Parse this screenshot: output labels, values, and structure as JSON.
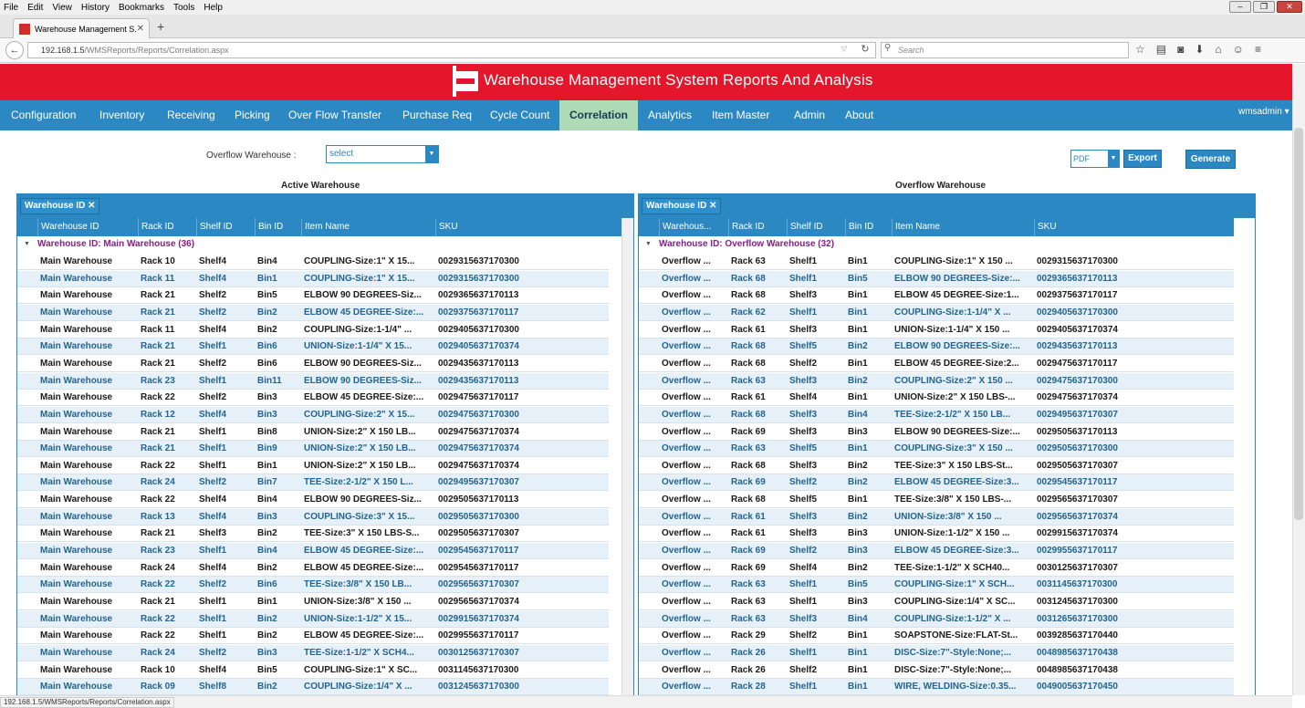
{
  "browser": {
    "menus": [
      "File",
      "Edit",
      "View",
      "History",
      "Bookmarks",
      "Tools",
      "Help"
    ],
    "tab_title": "Warehouse Management S...",
    "url_host": "192.168.1.5",
    "url_path": "/WMSReports/Reports/Correlation.aspx",
    "search_placeholder": "Search",
    "status_url": "192.168.1.5/WMSReports/Reports/Correlation.aspx"
  },
  "app": {
    "title": "Warehouse Management System Reports And Analysis",
    "user": "wmsadmin",
    "nav": [
      "Configuration",
      "Inventory",
      "Receiving",
      "Picking",
      "Over Flow Transfer",
      "Purchase Req",
      "Cycle Count",
      "Correlation",
      "Analytics",
      "Item Master",
      "Admin",
      "About"
    ],
    "active_nav": "Correlation"
  },
  "filters": {
    "overflow_label": "Overflow Warehouse :",
    "overflow_value": "select",
    "format_value": "PDF",
    "export_label": "Export",
    "generate_label": "Generate"
  },
  "active": {
    "title": "Active Warehouse",
    "chip": "Warehouse ID",
    "columns": [
      "Warehouse ID",
      "Rack ID",
      "Shelf ID",
      "Bin ID",
      "Item Name",
      "SKU"
    ],
    "group": "Warehouse ID: Main Warehouse (36)",
    "rows": [
      [
        "Main Warehouse",
        "Rack 10",
        "Shelf4",
        "Bin4",
        "COUPLING-Size:1\" X 15...",
        "0029315637170300"
      ],
      [
        "Main Warehouse",
        "Rack 11",
        "Shelf4",
        "Bin1",
        "COUPLING-Size:1\" X 15...",
        "0029315637170300"
      ],
      [
        "Main Warehouse",
        "Rack 21",
        "Shelf2",
        "Bin5",
        "ELBOW 90 DEGREES-Siz...",
        "0029365637170113"
      ],
      [
        "Main Warehouse",
        "Rack 21",
        "Shelf2",
        "Bin2",
        "ELBOW 45 DEGREE-Size:...",
        "0029375637170117"
      ],
      [
        "Main Warehouse",
        "Rack 11",
        "Shelf4",
        "Bin2",
        "COUPLING-Size:1-1/4\" ...",
        "0029405637170300"
      ],
      [
        "Main Warehouse",
        "Rack 21",
        "Shelf1",
        "Bin6",
        "UNION-Size:1-1/4\" X 15...",
        "0029405637170374"
      ],
      [
        "Main Warehouse",
        "Rack 21",
        "Shelf2",
        "Bin6",
        "ELBOW 90 DEGREES-Siz...",
        "0029435637170113"
      ],
      [
        "Main Warehouse",
        "Rack 23",
        "Shelf1",
        "Bin11",
        "ELBOW 90 DEGREES-Siz...",
        "0029435637170113"
      ],
      [
        "Main Warehouse",
        "Rack 22",
        "Shelf2",
        "Bin3",
        "ELBOW 45 DEGREE-Size:...",
        "0029475637170117"
      ],
      [
        "Main Warehouse",
        "Rack 12",
        "Shelf4",
        "Bin3",
        "COUPLING-Size:2\" X 15...",
        "0029475637170300"
      ],
      [
        "Main Warehouse",
        "Rack 21",
        "Shelf1",
        "Bin8",
        "UNION-Size:2\" X 150 LB...",
        "0029475637170374"
      ],
      [
        "Main Warehouse",
        "Rack 21",
        "Shelf1",
        "Bin9",
        "UNION-Size:2\" X 150 LB...",
        "0029475637170374"
      ],
      [
        "Main Warehouse",
        "Rack 22",
        "Shelf1",
        "Bin1",
        "UNION-Size:2\" X 150 LB...",
        "0029475637170374"
      ],
      [
        "Main Warehouse",
        "Rack 24",
        "Shelf2",
        "Bin7",
        "TEE-Size:2-1/2\" X 150 L...",
        "0029495637170307"
      ],
      [
        "Main Warehouse",
        "Rack 22",
        "Shelf4",
        "Bin4",
        "ELBOW 90 DEGREES-Siz...",
        "0029505637170113"
      ],
      [
        "Main Warehouse",
        "Rack 13",
        "Shelf4",
        "Bin3",
        "COUPLING-Size:3\" X 15...",
        "0029505637170300"
      ],
      [
        "Main Warehouse",
        "Rack 21",
        "Shelf3",
        "Bin2",
        "TEE-Size:3\" X 150 LBS-S...",
        "0029505637170307"
      ],
      [
        "Main Warehouse",
        "Rack 23",
        "Shelf1",
        "Bin4",
        "ELBOW 45 DEGREE-Size:...",
        "0029545637170117"
      ],
      [
        "Main Warehouse",
        "Rack 24",
        "Shelf4",
        "Bin2",
        "ELBOW 45 DEGREE-Size:...",
        "0029545637170117"
      ],
      [
        "Main Warehouse",
        "Rack 22",
        "Shelf2",
        "Bin6",
        "TEE-Size:3/8\" X 150 LB...",
        "0029565637170307"
      ],
      [
        "Main Warehouse",
        "Rack 21",
        "Shelf1",
        "Bin1",
        "UNION-Size:3/8\" X 150 ...",
        "0029565637170374"
      ],
      [
        "Main Warehouse",
        "Rack 22",
        "Shelf1",
        "Bin2",
        "UNION-Size:1-1/2\" X 15...",
        "0029915637170374"
      ],
      [
        "Main Warehouse",
        "Rack 22",
        "Shelf1",
        "Bin2",
        "ELBOW 45 DEGREE-Size:...",
        "0029955637170117"
      ],
      [
        "Main Warehouse",
        "Rack 24",
        "Shelf2",
        "Bin3",
        "TEE-Size:1-1/2\" X SCH4...",
        "0030125637170307"
      ],
      [
        "Main Warehouse",
        "Rack 10",
        "Shelf4",
        "Bin5",
        "COUPLING-Size:1\" X SC...",
        "0031145637170300"
      ],
      [
        "Main Warehouse",
        "Rack 09",
        "Shelf8",
        "Bin2",
        "COUPLING-Size:1/4\" X ...",
        "0031245637170300"
      ]
    ]
  },
  "overflow": {
    "title": "Overflow Warehouse",
    "chip": "Warehouse ID",
    "columns": [
      "Warehous...",
      "Rack ID",
      "Shelf ID",
      "Bin ID",
      "Item Name",
      "SKU"
    ],
    "group": "Warehouse ID: Overflow Warehouse (32)",
    "rows": [
      [
        "Overflow ...",
        "Rack 63",
        "Shelf1",
        "Bin1",
        "COUPLING-Size:1\" X 150 ...",
        "0029315637170300"
      ],
      [
        "Overflow ...",
        "Rack 68",
        "Shelf1",
        "Bin5",
        "ELBOW 90 DEGREES-Size:...",
        "0029365637170113"
      ],
      [
        "Overflow ...",
        "Rack 68",
        "Shelf3",
        "Bin1",
        "ELBOW 45 DEGREE-Size:1...",
        "0029375637170117"
      ],
      [
        "Overflow ...",
        "Rack 62",
        "Shelf1",
        "Bin1",
        "COUPLING-Size:1-1/4\" X ...",
        "0029405637170300"
      ],
      [
        "Overflow ...",
        "Rack 61",
        "Shelf3",
        "Bin1",
        "UNION-Size:1-1/4\" X 150 ...",
        "0029405637170374"
      ],
      [
        "Overflow ...",
        "Rack 68",
        "Shelf5",
        "Bin2",
        "ELBOW 90 DEGREES-Size:...",
        "0029435637170113"
      ],
      [
        "Overflow ...",
        "Rack 68",
        "Shelf2",
        "Bin1",
        "ELBOW 45 DEGREE-Size:2...",
        "0029475637170117"
      ],
      [
        "Overflow ...",
        "Rack 63",
        "Shelf3",
        "Bin2",
        "COUPLING-Size:2\" X 150 ...",
        "0029475637170300"
      ],
      [
        "Overflow ...",
        "Rack 61",
        "Shelf4",
        "Bin1",
        "UNION-Size:2\" X 150 LBS-...",
        "0029475637170374"
      ],
      [
        "Overflow ...",
        "Rack 68",
        "Shelf3",
        "Bin4",
        "TEE-Size:2-1/2\" X 150 LB...",
        "0029495637170307"
      ],
      [
        "Overflow ...",
        "Rack 69",
        "Shelf3",
        "Bin3",
        "ELBOW 90 DEGREES-Size:...",
        "0029505637170113"
      ],
      [
        "Overflow ...",
        "Rack 63",
        "Shelf5",
        "Bin1",
        "COUPLING-Size:3\" X 150 ...",
        "0029505637170300"
      ],
      [
        "Overflow ...",
        "Rack 68",
        "Shelf3",
        "Bin2",
        "TEE-Size:3\" X 150 LBS-St...",
        "0029505637170307"
      ],
      [
        "Overflow ...",
        "Rack 69",
        "Shelf2",
        "Bin2",
        "ELBOW 45 DEGREE-Size:3...",
        "0029545637170117"
      ],
      [
        "Overflow ...",
        "Rack 68",
        "Shelf5",
        "Bin1",
        "TEE-Size:3/8\" X 150 LBS-...",
        "0029565637170307"
      ],
      [
        "Overflow ...",
        "Rack 61",
        "Shelf3",
        "Bin2",
        "UNION-Size:3/8\" X 150 ...",
        "0029565637170374"
      ],
      [
        "Overflow ...",
        "Rack 61",
        "Shelf3",
        "Bin3",
        "UNION-Size:1-1/2\" X 150 ...",
        "0029915637170374"
      ],
      [
        "Overflow ...",
        "Rack 69",
        "Shelf2",
        "Bin3",
        "ELBOW 45 DEGREE-Size:3...",
        "0029955637170117"
      ],
      [
        "Overflow ...",
        "Rack 69",
        "Shelf4",
        "Bin2",
        "TEE-Size:1-1/2\" X SCH40...",
        "0030125637170307"
      ],
      [
        "Overflow ...",
        "Rack 63",
        "Shelf1",
        "Bin5",
        "COUPLING-Size:1\" X SCH...",
        "0031145637170300"
      ],
      [
        "Overflow ...",
        "Rack 63",
        "Shelf1",
        "Bin3",
        "COUPLING-Size:1/4\" X SC...",
        "0031245637170300"
      ],
      [
        "Overflow ...",
        "Rack 63",
        "Shelf3",
        "Bin4",
        "COUPLING-Size:1-1/2\" X ...",
        "0031265637170300"
      ],
      [
        "Overflow ...",
        "Rack 29",
        "Shelf2",
        "Bin1",
        "SOAPSTONE-Size:FLAT-St...",
        "0039285637170440"
      ],
      [
        "Overflow ...",
        "Rack 26",
        "Shelf1",
        "Bin1",
        "DISC-Size:7\"-Style:None;...",
        "0048985637170438"
      ],
      [
        "Overflow ...",
        "Rack 26",
        "Shelf2",
        "Bin1",
        "DISC-Size:7\"-Style:None;...",
        "0048985637170438"
      ],
      [
        "Overflow ...",
        "Rack 28",
        "Shelf1",
        "Bin1",
        "WIRE, WELDING-Size:0.35...",
        "0049005637170450"
      ]
    ]
  }
}
